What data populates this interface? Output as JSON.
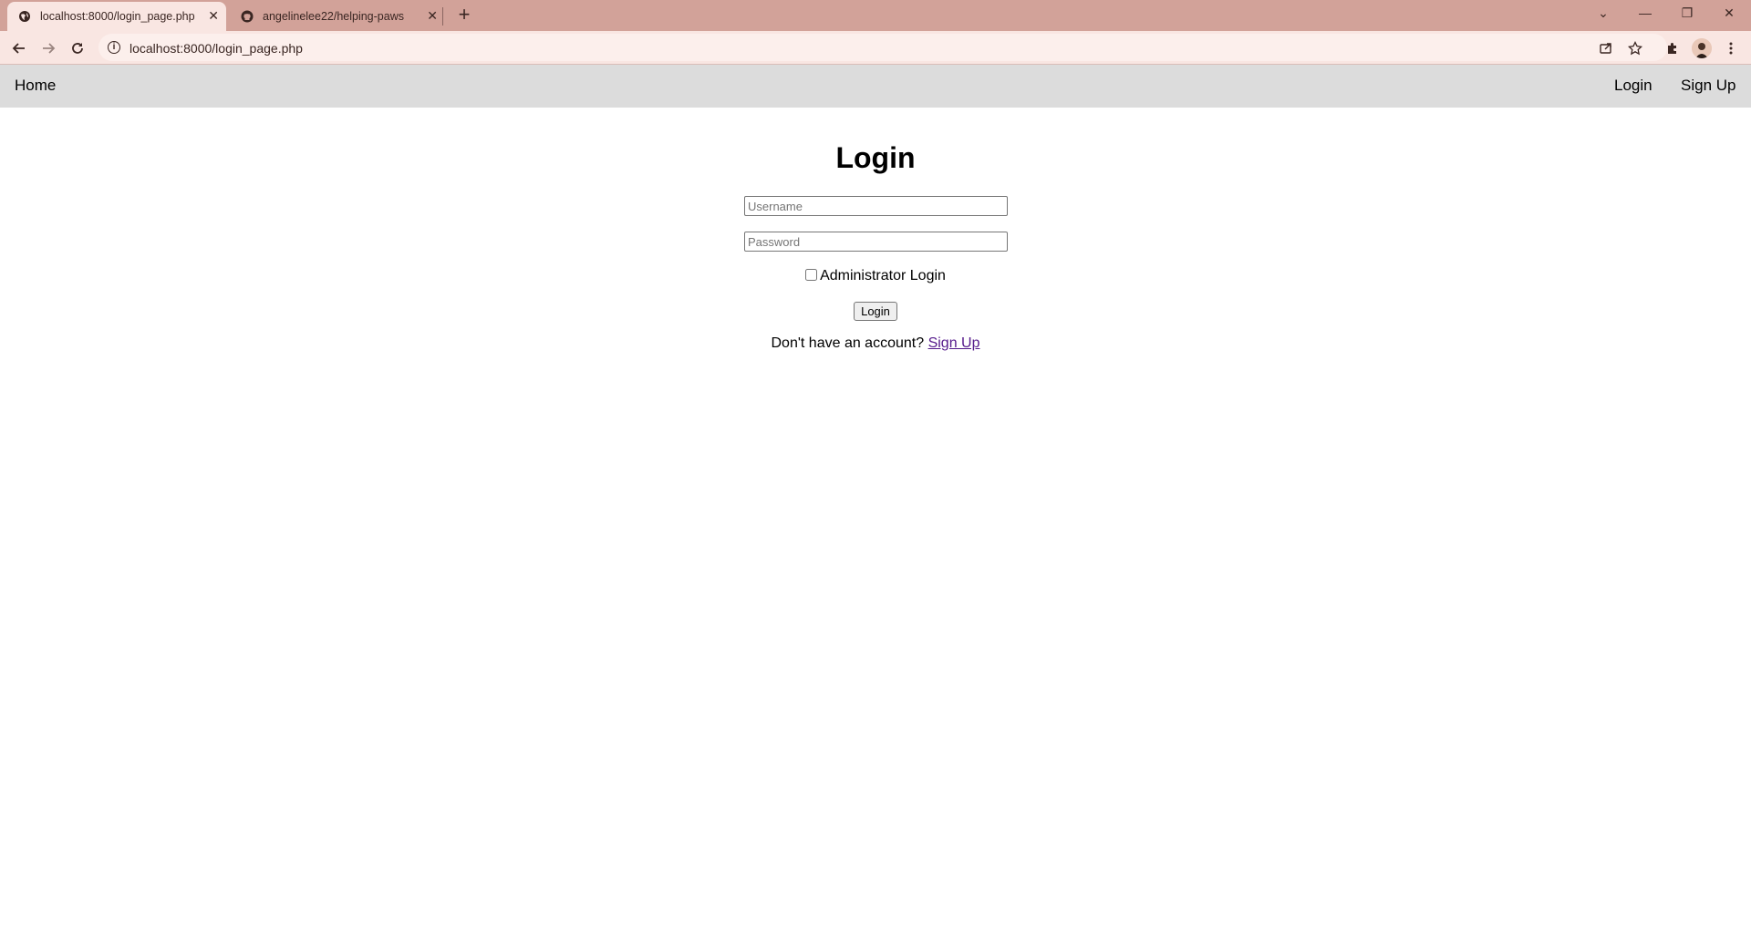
{
  "browser": {
    "tabs": [
      {
        "title": "localhost:8000/login_page.php",
        "favicon": "globe-icon",
        "active": true
      },
      {
        "title": "angelinelee22/helping-paws",
        "favicon": "github-icon",
        "active": false
      }
    ],
    "close_glyph": "✕",
    "new_tab_glyph": "+",
    "url": "localhost:8000/login_page.php",
    "window_controls": {
      "dropdown": "⌄",
      "minimize": "—",
      "restore": "❐",
      "close": "✕"
    },
    "colors": {
      "frame": "#d2a299",
      "toolbar": "#f9e6e2"
    }
  },
  "site_nav": {
    "home": "Home",
    "login": "Login",
    "signup": "Sign Up"
  },
  "login": {
    "title": "Login",
    "username_placeholder": "Username",
    "password_placeholder": "Password",
    "admin_label": "Administrator Login",
    "admin_checked": false,
    "button": "Login",
    "no_account_text": "Don't have an account?",
    "signup_link": "Sign Up"
  }
}
